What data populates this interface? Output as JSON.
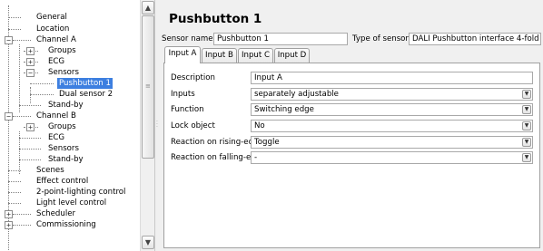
{
  "tree": {
    "items": [
      {
        "label": "General"
      },
      {
        "label": "Location"
      },
      {
        "label": "Channel A",
        "expander": "−"
      },
      {
        "label": "Groups",
        "expander": "+"
      },
      {
        "label": "ECG",
        "expander": "+"
      },
      {
        "label": "Sensors",
        "expander": "−"
      },
      {
        "label": "Pushbutton 1",
        "selected": true
      },
      {
        "label": "Dual sensor 2"
      },
      {
        "label": "Stand-by"
      },
      {
        "label": "Channel B",
        "expander": "−"
      },
      {
        "label": "Groups",
        "expander": "+"
      },
      {
        "label": "ECG"
      },
      {
        "label": "Sensors"
      },
      {
        "label": "Stand-by"
      },
      {
        "label": "Scenes"
      },
      {
        "label": "Effect control"
      },
      {
        "label": "2-point-lighting control"
      },
      {
        "label": "Light level control"
      },
      {
        "label": "Scheduler",
        "expander": "+"
      },
      {
        "label": "Commissioning",
        "expander": "+"
      }
    ]
  },
  "scrollbar": {
    "up_icon": "▲",
    "down_icon": "▼",
    "grip": "≡"
  },
  "header": {
    "title": "Pushbutton 1",
    "sensor_name_label": "Sensor name",
    "sensor_name_value": "Pushbutton 1",
    "sensor_type_label": "Type of sensor:",
    "sensor_type_value": "DALI Pushbutton interface 4-fold"
  },
  "tabs": [
    {
      "label": "Input A",
      "active": true
    },
    {
      "label": "Input B"
    },
    {
      "label": "Input C"
    },
    {
      "label": "Input D"
    }
  ],
  "params": [
    {
      "label": "Description",
      "value": "Input A",
      "dropdown": false
    },
    {
      "label": "Inputs",
      "value": "separately adjustable",
      "dropdown": true
    },
    {
      "label": "Function",
      "value": "Switching edge",
      "dropdown": true
    },
    {
      "label": "Lock object",
      "value": "No",
      "dropdown": true
    },
    {
      "label": "Reaction on rising-edge",
      "value": "Toggle",
      "dropdown": true
    },
    {
      "label": "Reaction on falling-edge",
      "value": "-",
      "dropdown": true
    }
  ],
  "colors": {
    "selection": "#3d7fe0",
    "panel_bg": "#f0f0f0"
  }
}
